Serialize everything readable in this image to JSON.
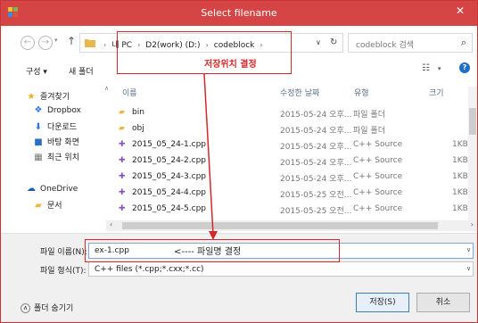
{
  "window": {
    "title": "Select filename",
    "close_label": "✕"
  },
  "address": {
    "crumbs": [
      "내 PC",
      "D2(work) (D:)",
      "codeblock"
    ],
    "search_placeholder": "codeblock 검색"
  },
  "toolbar": {
    "organize": "구성 ▾",
    "new_folder": "새 폴더"
  },
  "nav": {
    "items": [
      {
        "label": "즐겨찾기",
        "icon": "star-icon"
      },
      {
        "label": "Dropbox",
        "icon": "dropbox-icon"
      },
      {
        "label": "다운로드",
        "icon": "download-folder-icon"
      },
      {
        "label": "바탕 화면",
        "icon": "desktop-icon"
      },
      {
        "label": "최근 위치",
        "icon": "recent-places-icon"
      },
      {
        "label": "OneDrive",
        "icon": "onedrive-icon"
      },
      {
        "label": "문서",
        "icon": "documents-folder-icon"
      }
    ]
  },
  "list": {
    "columns": [
      "이름",
      "수정한 날짜",
      "유형",
      "크기"
    ],
    "rows": [
      {
        "name": "bin",
        "date": "2015-05-24 오후...",
        "type": "파일 폴더",
        "size": "",
        "icon": "folder-icon"
      },
      {
        "name": "obj",
        "date": "2015-05-24 오후...",
        "type": "파일 폴더",
        "size": "",
        "icon": "folder-icon"
      },
      {
        "name": "2015_05_24-1.cpp",
        "date": "2015-05-24 오후...",
        "type": "C++ Source",
        "size": "1KB",
        "icon": "cpp-file-icon"
      },
      {
        "name": "2015_05_24-2.cpp",
        "date": "2015-05-24 오후...",
        "type": "C++ Source",
        "size": "1KB",
        "icon": "cpp-file-icon"
      },
      {
        "name": "2015_05_24-3.cpp",
        "date": "2015-05-24 오후...",
        "type": "C++ Source",
        "size": "1KB",
        "icon": "cpp-file-icon"
      },
      {
        "name": "2015_05_24-4.cpp",
        "date": "2015-05-25 오전...",
        "type": "C++ Source",
        "size": "1KB",
        "icon": "cpp-file-icon"
      },
      {
        "name": "2015_05_24-5.cpp",
        "date": "2015-05-25 오전...",
        "type": "C++ Source",
        "size": "1KB",
        "icon": "cpp-file-icon"
      }
    ]
  },
  "bottom": {
    "filename_label": "파일 이름(N):",
    "filename_value": "ex-1.cpp",
    "filetype_label": "파일 형식(T):",
    "filetype_value": "C++ files (*.cpp;*.cxx;*.cc)",
    "hide_folders": "폴더 숨기기",
    "save_button": "저장(S)",
    "cancel_button": "취소"
  },
  "annotations": {
    "save_location": "저장위치 결정",
    "filename_arrow": "<----",
    "filename_note": "파일명 결정",
    "color": "#d62828"
  }
}
